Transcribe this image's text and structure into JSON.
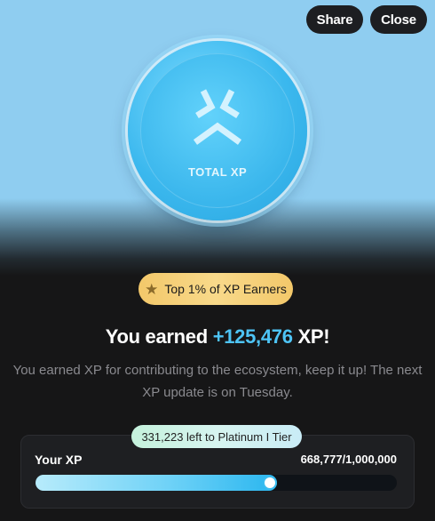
{
  "header": {
    "share_label": "Share",
    "close_label": "Close"
  },
  "coin": {
    "label": "TOTAL XP",
    "icon": "xp-logo-icon"
  },
  "badge": {
    "icon": "star-icon",
    "text": "Top 1% of XP Earners"
  },
  "headline": {
    "prefix": "You earned ",
    "amount": "+125,476",
    "suffix": " XP!"
  },
  "description": "You earned XP for contributing to the ecosystem, keep it up! The next XP update is on Tuesday.",
  "xp_card": {
    "tier_pill": "331,223 left to Platinum I Tier",
    "label": "Your XP",
    "value_text": "668,777/1,000,000",
    "current": 668777,
    "max": 1000000
  },
  "colors": {
    "accent": "#4ec4f5",
    "badge_gold": "#f3c86a",
    "background": "#161617",
    "hero_sky": "#8fcdf0"
  }
}
